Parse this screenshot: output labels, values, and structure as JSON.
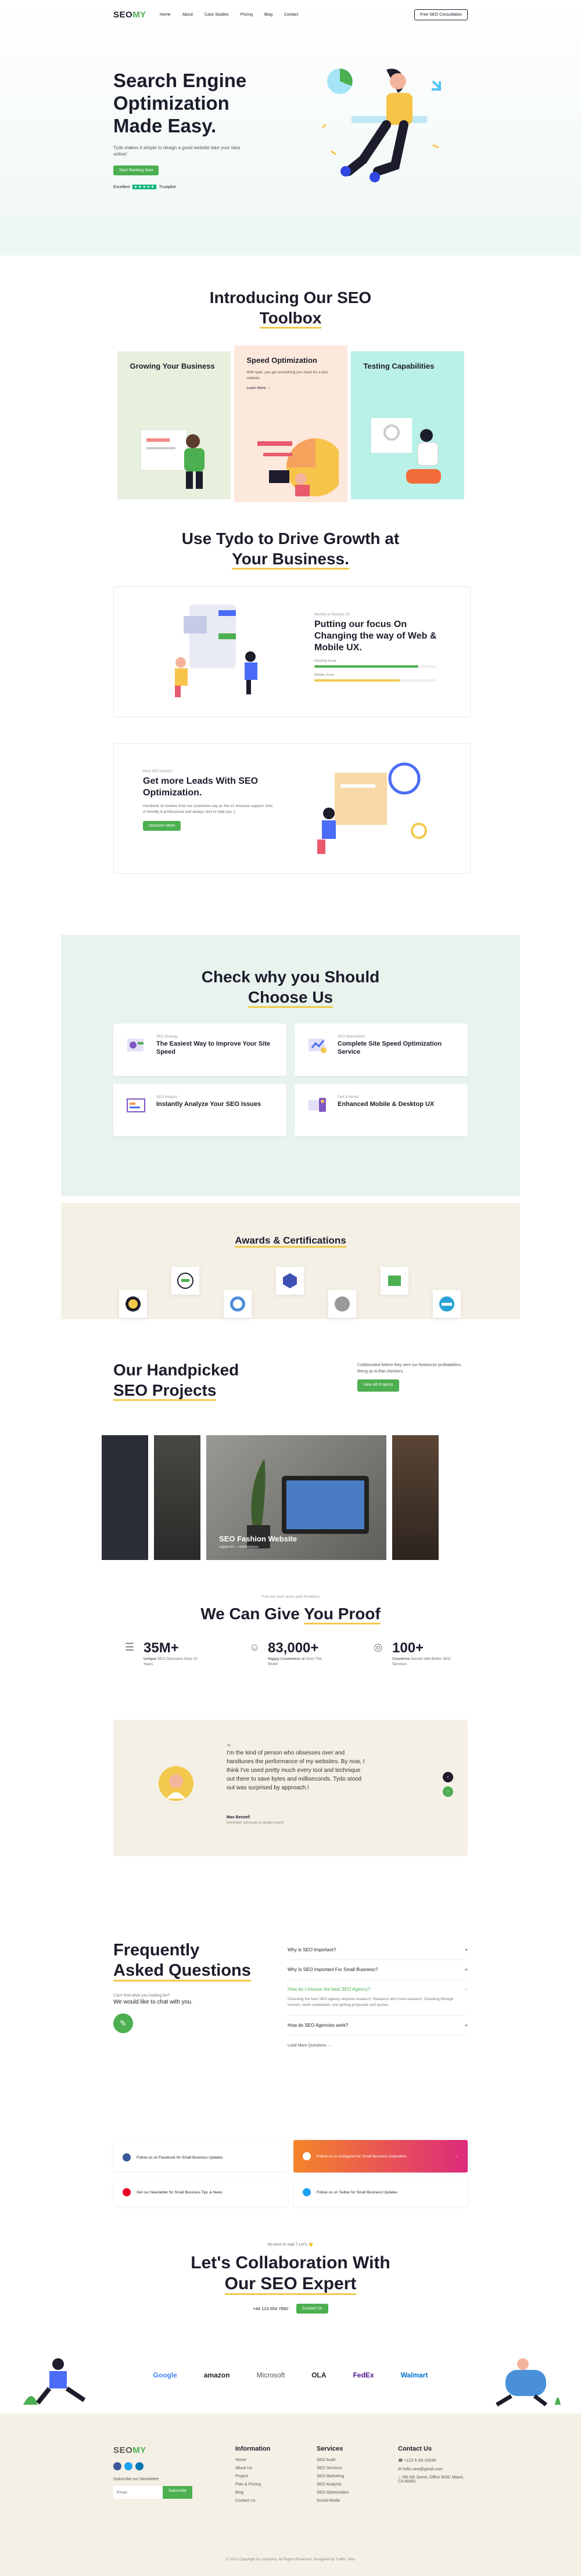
{
  "nav": {
    "logo_a": "SEO",
    "logo_b": "MY",
    "items": [
      "Home",
      "About",
      "Case Studies",
      "Pricing",
      "Blog",
      "Contact"
    ],
    "cta": "Free SEO Consultation"
  },
  "hero": {
    "title": "Search Engine Optimization Made Easy.",
    "subtitle": "Tydo makes it simple to design a good website take your idea online!",
    "button": "Start Ranking Now",
    "rating_label": "Excellent",
    "stars": "★★★★★",
    "trustpilot": "Trustpilot"
  },
  "toolbox": {
    "title_a": "Introducing Our SEO",
    "title_b": "Toolbox",
    "cards": [
      {
        "title": "Growing Your Business",
        "bg": "#e7f0dc"
      },
      {
        "title": "Speed Optimization",
        "text": "With tydo, you get everything you need for a fast website.",
        "link": "Learn More →",
        "bg": "#fde9dc"
      },
      {
        "title": "Testing Capabilities",
        "bg": "#b9f0e7"
      }
    ]
  },
  "growth": {
    "title_a": "Use Tydo to Drive Growth at",
    "title_b": "Your Business.",
    "f1": {
      "small": "Monthly to Desktop UX",
      "title": "Putting our focus On Changing the way of Web & Mobile UX.",
      "bar1_label": "Desktop Issue",
      "bar1_value": 0.85,
      "bar2_label": "Mobile Issue",
      "bar2_value": 0.7
    },
    "f2": {
      "small": "More SEO results?",
      "title": "Get more Leads With SEO Optimization.",
      "text": "Hundreds of reviews from our customers say as the #1 insecure support: bots in friendly & professional and always very to help you :)",
      "button": "Discover More"
    }
  },
  "why": {
    "title_a": "Check why you Should",
    "title_b": "Choose Us",
    "cards": [
      {
        "small": "SEO Strategy",
        "title": "The Easiest Way to Improve Your Site Speed"
      },
      {
        "small": "SEO Optimization",
        "title": "Complete Site Speed Optimization Service"
      },
      {
        "small": "SEO Analysis",
        "title": "Instantly Analyze Your SEO Issues"
      },
      {
        "small": "Fast & Mobile",
        "title": "Enhanced Mobile & Desktop UX"
      }
    ]
  },
  "awards": {
    "title": "Awards & Certifications"
  },
  "projects": {
    "title_a": "Our Handpicked",
    "title_b": "SEO Projects",
    "text": "Collaborated before they sent our freelancer profitabilities. Being an A-that checkers.",
    "button": "View All Projects",
    "featured_title": "SEO Fashion Website",
    "featured_sub": "Digital Art — Marketplace"
  },
  "proof": {
    "small": "Find our each since web Providers",
    "title_a": "We Can Give",
    "title_b": "You Proof",
    "stats": [
      {
        "value": "35M+",
        "label_b": "Unique",
        "label": "SEO Discovers Over 10 Years"
      },
      {
        "value": "83,000+",
        "label_b": "Happy Customers",
        "label": "all Over The World"
      },
      {
        "value": "100+",
        "label_b": "Countries",
        "label": "Served with Better SEO Services"
      }
    ],
    "quote": "I'm the kind of person who obsesses over and handtunes the performance of my websites. By now, I think I've used pretty much every tool and technique out there to save bytes and milliseconds. Tydo stood out was surprised by approach.!",
    "author": "Max Benzell",
    "author_role": "Developer advocate at google export"
  },
  "faq": {
    "title_a": "Frequently",
    "title_b": "Asked Questions",
    "q1": "Can't find what you looking for?",
    "q2": "We would like to chat with you.",
    "items": [
      {
        "q": "Why is SEO Important?"
      },
      {
        "q": "Why Is SEO Important For Small Business?"
      },
      {
        "q": "How do I choose the best SEO Agency?",
        "a": "Choosing the best SEO agency requires research. Research and more research. Checking through reviews, team credentials, and getting proposals and quotes."
      },
      {
        "q": "How do SEO Agencies work?"
      }
    ],
    "more": "Load More Questions →"
  },
  "social": {
    "facebook": "Follow us on Facebook for Small Business Updates",
    "instagram": "Follow us on Instagram for Small Business inspiration",
    "pinterest": "Get our Newsletter for Small Business Tips & News",
    "twitter": "Follow us on Twitter for Small Business Updates"
  },
  "collab": {
    "small": "No time to wait ? Let's 👋",
    "title_a": "Let's Collaboration With",
    "title_b": "Our SEO Expert",
    "phone": "+44 123 654 7890",
    "button": "Contact Us",
    "brands": [
      "Google",
      "amazon",
      "Microsoft",
      "OLA",
      "FedEx",
      "Walmart"
    ]
  },
  "footer": {
    "logo_a": "SEO",
    "logo_b": "MY",
    "newsletter": "Subscribe our Newsletter",
    "email_placeholder": "Email",
    "subscribe": "Subscribe",
    "info_title": "Information",
    "info": [
      "Home",
      "About Us",
      "Project",
      "Plan & Pricing",
      "Blog",
      "Contact Us"
    ],
    "services_title": "Services",
    "services": [
      "SEO Audit",
      "SEO Services",
      "SEO Marketing",
      "SEO Analysis",
      "SEO Optimization",
      "Social Media"
    ],
    "contact_title": "Contact Us",
    "contact": [
      "+123 5 3G-33345",
      "hello.next@gmail.com",
      "785 5th Street, Office 800C Miami, CA 88362"
    ],
    "copyright": "© 2021 Copyright by company. All Rights Reserved. Designed by Traffic_Plus"
  }
}
